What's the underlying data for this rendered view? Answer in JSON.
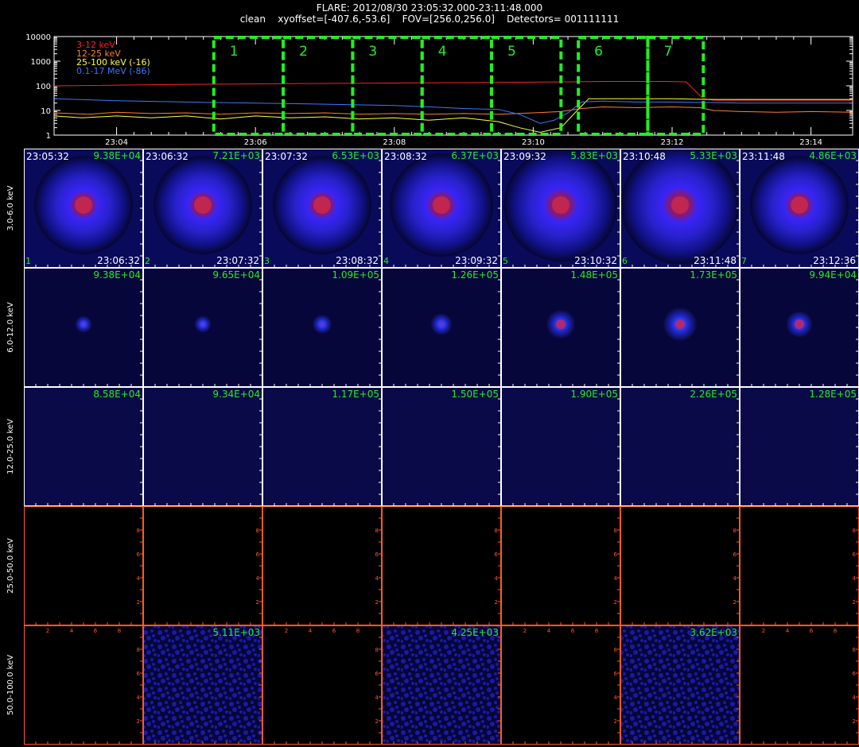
{
  "header": {
    "title": "FLARE: 2012/08/30 23:05:32.000-23:11:48.000",
    "subtitle": "clean    xyoffset=[-407.6,-53.6]    FOV=[256.0,256.0]    Detectors= 001111111"
  },
  "colors": {
    "frame": "#ffffff",
    "grid_red": "#ff5a28",
    "interval_green": "#22ee22",
    "label_green": "#22ee22",
    "ch1": "#ff2222",
    "ch2": "#ff7f2a",
    "ch3": "#ffff40",
    "ch4": "#3a78ff"
  },
  "chart_data": [
    {
      "type": "line",
      "x_ticks": [
        "23:04",
        "23:06",
        "23:08",
        "23:10",
        "23:12",
        "23:14"
      ],
      "y_ticks": [
        "1",
        "10",
        "100",
        "1000",
        "10000"
      ],
      "ylim": [
        1,
        10000
      ],
      "y_scale": "log",
      "xlim_min": [
        3.1,
        14.6
      ],
      "legend_position": "top-left",
      "intervals": [
        {
          "label": "1",
          "start": 5.4,
          "end": 6.4
        },
        {
          "label": "2",
          "start": 6.4,
          "end": 7.4
        },
        {
          "label": "3",
          "start": 7.4,
          "end": 8.4
        },
        {
          "label": "4",
          "start": 8.4,
          "end": 9.4
        },
        {
          "label": "5",
          "start": 9.4,
          "end": 10.4
        },
        {
          "label": "6",
          "start": 10.65,
          "end": 11.65
        },
        {
          "label": "7",
          "start": 11.65,
          "end": 12.45
        }
      ],
      "series": [
        {
          "name": "3-12 keV",
          "points": [
            [
              3.1,
              100
            ],
            [
              5,
              115
            ],
            [
              7,
              125
            ],
            [
              9,
              135
            ],
            [
              10.5,
              145
            ],
            [
              11,
              150
            ],
            [
              11.9,
              150
            ],
            [
              12.2,
              145
            ],
            [
              12.45,
              30
            ],
            [
              12.6,
              26
            ],
            [
              14.6,
              26
            ]
          ]
        },
        {
          "name": "12-25 keV",
          "points": [
            [
              3.1,
              8
            ],
            [
              3.6,
              7
            ],
            [
              4,
              8.5
            ],
            [
              4.5,
              7.5
            ],
            [
              5,
              8
            ],
            [
              5.5,
              7
            ],
            [
              6,
              8
            ],
            [
              6.5,
              7.5
            ],
            [
              7,
              8
            ],
            [
              7.5,
              7
            ],
            [
              8,
              7.5
            ],
            [
              8.5,
              7
            ],
            [
              9,
              7.5
            ],
            [
              9.5,
              7
            ],
            [
              10,
              8
            ],
            [
              10.4,
              9
            ],
            [
              10.7,
              12
            ],
            [
              11,
              14
            ],
            [
              11.5,
              13
            ],
            [
              12,
              14
            ],
            [
              12.4,
              13
            ],
            [
              12.6,
              10
            ],
            [
              13,
              9
            ],
            [
              13.5,
              8.5
            ],
            [
              14,
              9
            ],
            [
              14.6,
              8.5
            ]
          ]
        },
        {
          "name": "25-100 keV (-16)",
          "points": [
            [
              3.1,
              6
            ],
            [
              3.5,
              5
            ],
            [
              4,
              6
            ],
            [
              4.5,
              5
            ],
            [
              5,
              6
            ],
            [
              5.5,
              4.5
            ],
            [
              6,
              6
            ],
            [
              6.5,
              5
            ],
            [
              7,
              5.5
            ],
            [
              7.5,
              4.5
            ],
            [
              8,
              5
            ],
            [
              8.5,
              4
            ],
            [
              9,
              5
            ],
            [
              9.5,
              3.5
            ],
            [
              9.8,
              2
            ],
            [
              10.1,
              1.3
            ],
            [
              10.4,
              2
            ],
            [
              10.6,
              8
            ],
            [
              10.8,
              30
            ],
            [
              11.5,
              30
            ],
            [
              12,
              30
            ],
            [
              12.5,
              28
            ],
            [
              13,
              28
            ],
            [
              14,
              28
            ],
            [
              14.6,
              28
            ]
          ]
        },
        {
          "name": "0.1-17 MeV (-86)",
          "points": [
            [
              3.1,
              30
            ],
            [
              4,
              25
            ],
            [
              5,
              22
            ],
            [
              6,
              20
            ],
            [
              7,
              18
            ],
            [
              8,
              16
            ],
            [
              8.5,
              14
            ],
            [
              9,
              12
            ],
            [
              9.5,
              11
            ],
            [
              9.8,
              7
            ],
            [
              10.1,
              3
            ],
            [
              10.3,
              4
            ],
            [
              10.5,
              8
            ],
            [
              10.7,
              22
            ],
            [
              11,
              24
            ],
            [
              11.5,
              22
            ],
            [
              12,
              22
            ],
            [
              12.5,
              21
            ],
            [
              13,
              20
            ],
            [
              14,
              20
            ],
            [
              14.6,
              20
            ]
          ]
        }
      ]
    },
    {
      "type": "heatmap",
      "energy_bands": [
        "3.0-6.0 keV",
        "6.0-12.0 keV",
        "12.0-25.0 keV",
        "25.0-50.0 keV",
        "50.0-100.0 keV"
      ],
      "interval_numbers": [
        "1",
        "2",
        "3",
        "4",
        "5",
        "6",
        "7"
      ],
      "start_times": [
        "23:05:32",
        "23:06:32",
        "23:07:32",
        "23:08:32",
        "23:09:32",
        "23:10:48",
        "23:11:48"
      ],
      "end_times": [
        "23:06:32",
        "23:07:32",
        "23:08:32",
        "23:09:32",
        "23:10:32",
        "23:11:48",
        "23:12:36"
      ],
      "tick_labels": [
        "2",
        "4",
        "6",
        "8"
      ],
      "peak_labels": [
        [
          "9.38E+04",
          "7.21E+03",
          "6.53E+03",
          "6.37E+03",
          "5.83E+03",
          "5.33E+03",
          "4.86E+03"
        ],
        [
          "9.38E+04",
          "9.65E+04",
          "1.09E+05",
          "1.26E+05",
          "1.48E+05",
          "1.73E+05",
          "9.94E+04"
        ],
        [
          "8.58E+04",
          "9.34E+04",
          "1.17E+05",
          "1.50E+05",
          "1.90E+05",
          "2.26E+05",
          "1.28E+05"
        ],
        [
          "",
          "",
          "",
          "",
          "",
          "",
          ""
        ],
        [
          "",
          "5.11E+03",
          "",
          "4.25E+03",
          "",
          "3.62E+03",
          ""
        ]
      ],
      "source_size": [
        [
          1.0,
          1.0,
          1.0,
          1.05,
          1.15,
          1.2,
          1.0
        ],
        [
          0.35,
          0.35,
          0.4,
          0.45,
          0.6,
          0.7,
          0.55
        ],
        [
          0,
          0,
          0,
          0,
          0,
          0,
          0
        ],
        [
          0,
          0,
          0,
          0,
          0,
          0,
          0
        ],
        [
          0,
          0,
          0,
          0,
          0,
          0,
          0
        ]
      ],
      "panel_state": [
        [
          "source",
          "source",
          "source",
          "source",
          "source",
          "source",
          "source"
        ],
        [
          "source",
          "source",
          "source",
          "source",
          "source",
          "source",
          "source"
        ],
        [
          "flat",
          "flat",
          "flat",
          "flat",
          "flat",
          "flat",
          "flat"
        ],
        [
          "empty",
          "empty",
          "empty",
          "empty",
          "empty",
          "empty",
          "empty"
        ],
        [
          "empty",
          "noise",
          "empty",
          "noise",
          "empty",
          "noise",
          "empty"
        ]
      ]
    }
  ]
}
